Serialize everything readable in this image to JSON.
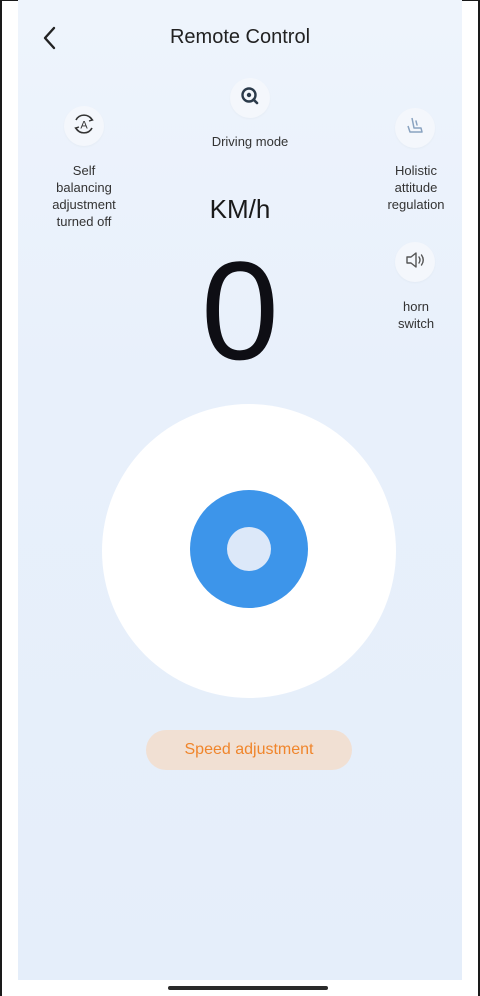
{
  "header": {
    "title": "Remote Control",
    "back_icon": "chevron-left-icon"
  },
  "controls": {
    "driving_mode": {
      "label": "Driving mode",
      "icon": "steering-search-icon"
    },
    "self_balancing": {
      "label_lines": [
        "Self",
        "balancing",
        "adjustment",
        "turned off"
      ],
      "icon": "auto-rotate-icon"
    },
    "holistic_attitude": {
      "label_lines": [
        "Holistic",
        "attitude",
        "regulation"
      ],
      "icon": "seat-icon"
    },
    "horn": {
      "label_lines": [
        "horn",
        "switch"
      ],
      "icon": "speaker-icon"
    }
  },
  "speedometer": {
    "unit": "KM/h",
    "value": "0"
  },
  "joystick": {
    "base_color": "#ffffff",
    "knob_color": "#3d95ea",
    "center_color": "#dce8f9"
  },
  "footer": {
    "speed_adjustment_label": "Speed adjustment",
    "accent_color": "#f0852b"
  }
}
